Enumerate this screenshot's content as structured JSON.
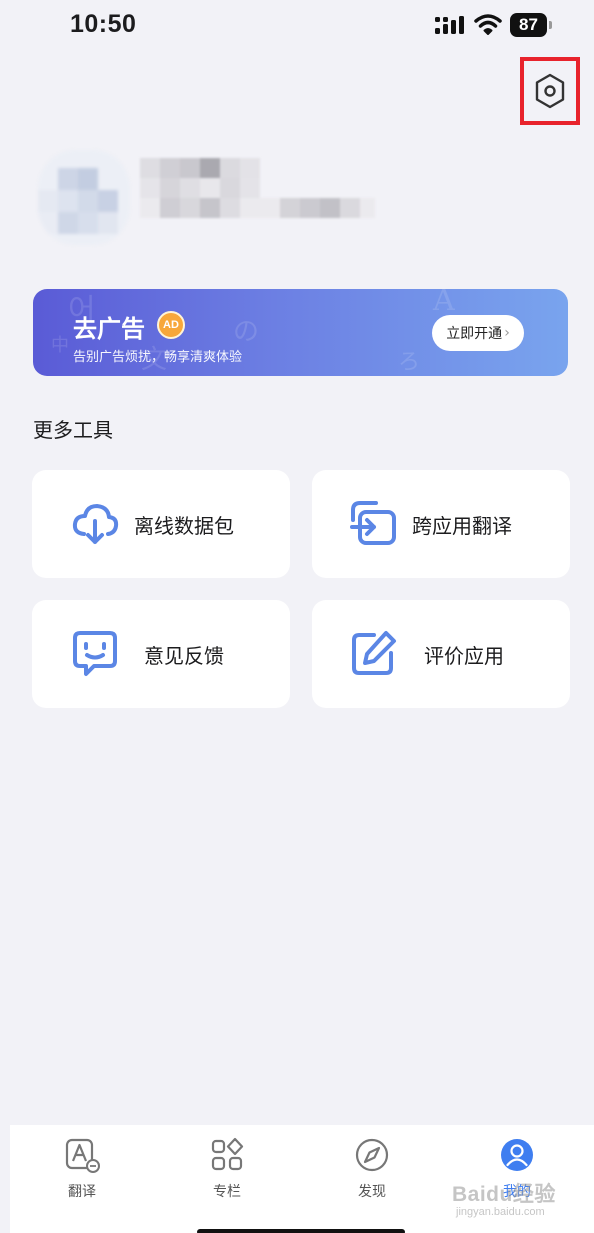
{
  "status_bar": {
    "time": "10:50",
    "battery": "87"
  },
  "banner": {
    "title": "去广告",
    "badge": "AD",
    "subtitle": "告别广告烦扰，畅享清爽体验",
    "button_label": "立即开通",
    "button_chevron": "›",
    "bg_glyphs": [
      "어",
      "中",
      "文",
      "の",
      "A",
      "ろ"
    ]
  },
  "tools": {
    "title": "更多工具",
    "items": [
      {
        "label": "离线数据包",
        "icon": "cloud-download-icon"
      },
      {
        "label": "跨应用翻译",
        "icon": "cross-app-icon"
      },
      {
        "label": "意见反馈",
        "icon": "feedback-icon"
      },
      {
        "label": "评价应用",
        "icon": "edit-icon"
      }
    ]
  },
  "tabbar": {
    "tabs": [
      {
        "label": "翻译",
        "icon": "translate-icon"
      },
      {
        "label": "专栏",
        "icon": "grid-icon"
      },
      {
        "label": "发现",
        "icon": "compass-icon"
      },
      {
        "label": "我的",
        "icon": "profile-icon",
        "active": true
      }
    ]
  },
  "watermark": {
    "main": "Baidu经验",
    "sub": "jingyan.baidu.com"
  },
  "colors": {
    "accent": "#3f7ef0",
    "tool_icon": "#5b86e5",
    "highlight_box": "#e8232c"
  }
}
